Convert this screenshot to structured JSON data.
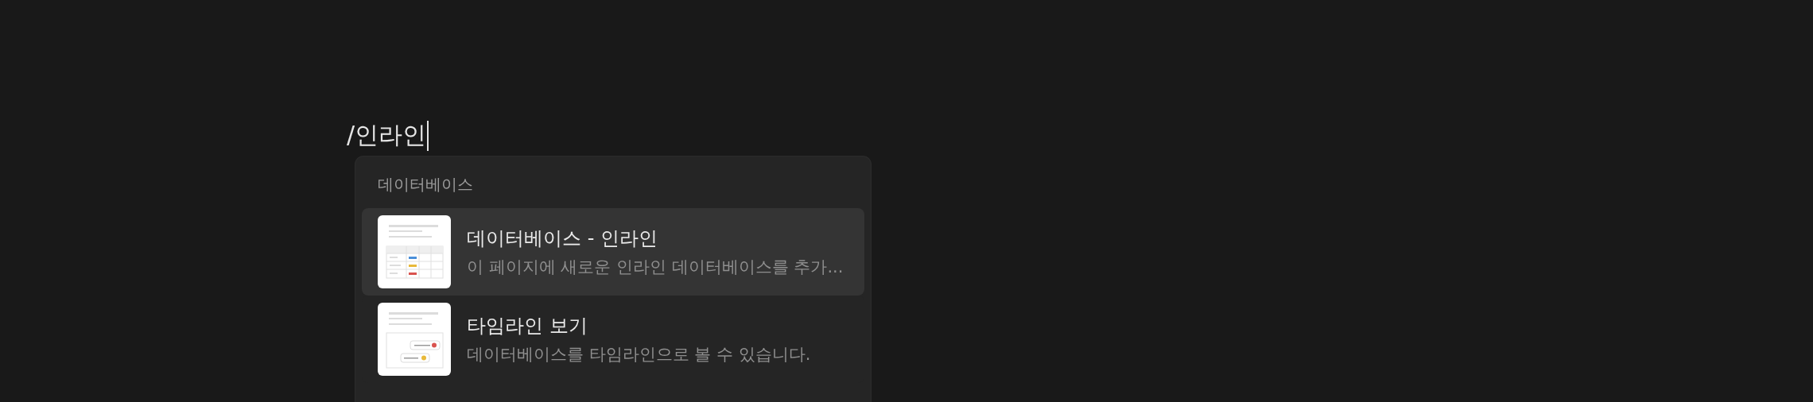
{
  "command": {
    "value": "/인라인"
  },
  "menu": {
    "section": "데이터베이스",
    "items": [
      {
        "kind": "table",
        "title": "데이터베이스 - 인라인",
        "description": "이 페이지에 새로운 인라인 데이터베이스를 추가...",
        "selected": true
      },
      {
        "kind": "timeline",
        "title": "타임라인 보기",
        "description": "데이터베이스를 타임라인으로 볼 수 있습니다.",
        "selected": false
      }
    ]
  }
}
